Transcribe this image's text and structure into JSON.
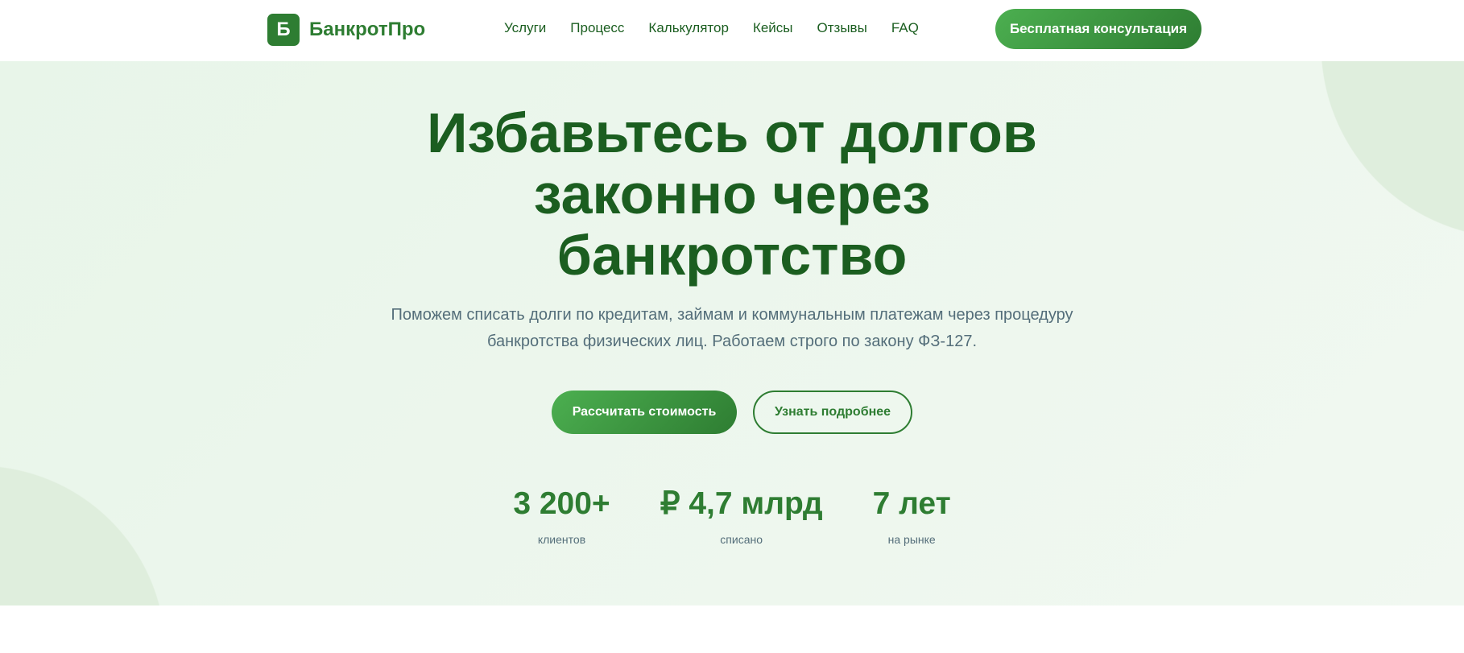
{
  "header": {
    "logo_letter": "Б",
    "logo_text": "БанкротПро",
    "nav": [
      "Услуги",
      "Процесс",
      "Калькулятор",
      "Кейсы",
      "Отзывы",
      "FAQ"
    ],
    "cta": "Бесплатная консультация"
  },
  "hero": {
    "title": "Избавьтесь от долгов законно через банкротство",
    "subtitle": "Поможем списать долги по кредитам, займам и коммунальным платежам через процедуру банкротства физических лиц. Работаем строго по закону ФЗ-127.",
    "primary_button": "Рассчитать стоимость",
    "secondary_button": "Узнать подробнее",
    "stats": [
      {
        "value": "3 200+",
        "label": "клиентов"
      },
      {
        "value": "₽ 4,7 млрд",
        "label": "списано"
      },
      {
        "value": "7 лет",
        "label": "на рынке"
      }
    ]
  },
  "colors": {
    "primary": "#2e7d32",
    "dark": "#1b5e20",
    "text_muted": "#546e7a"
  }
}
